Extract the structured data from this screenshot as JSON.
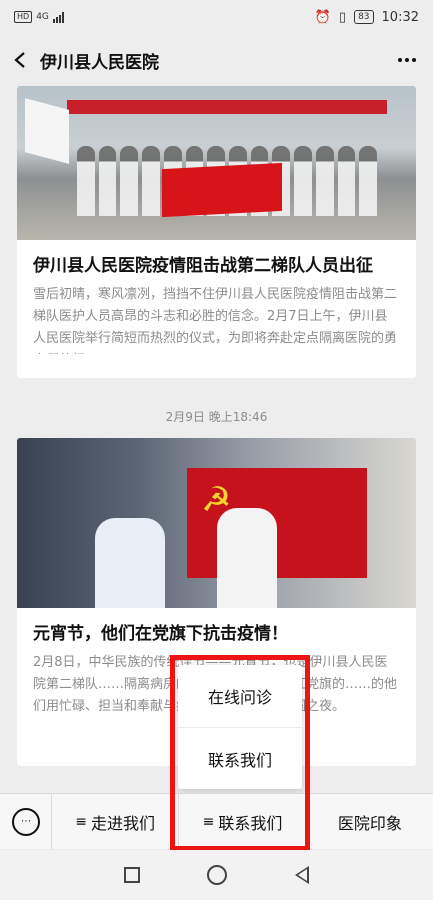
{
  "status_bar": {
    "network_tag": "HD",
    "network_type": "4G",
    "battery": "83",
    "time": "10:32",
    "icons": [
      "alarm-icon",
      "vibrate-icon",
      "battery-icon",
      "signal-icon"
    ]
  },
  "header": {
    "title": "伊川县人民医院",
    "icons": [
      "back-arrow-icon",
      "more-icon"
    ]
  },
  "feed": {
    "articles": [
      {
        "image": "medical-team-group-photo",
        "title": "伊川县人民医院疫情阻击战第二梯队人员出征",
        "summary": "雪后初晴，寒风凛冽，挡挡不住伊川县人民医院疫情阻击战第二梯队医护人员高昂的斗志和必胜的信念。2月7日上午，伊川县人民医院举行简短而热烈的仪式，为即将奔赴定点隔离医院的勇士们壮行。"
      },
      {
        "image": "medical-staff-party-flag-photo",
        "title": "元宵节，他们在党旗下抗击疫情！",
        "summary": "2月8日，中华民族的传统佳节——元宵节，也是伊川县人民医院第二梯队……隔离病房的第二个夜晚，在鲜红党旗的……的他们用忙碌、担当和奉献与病……这个特殊的团圆之夜。"
      }
    ],
    "date_separator": "2月9日 晚上18:46"
  },
  "popup_menu": {
    "items": [
      "在线问诊",
      "联系我们"
    ]
  },
  "menu_bar": {
    "keyboard_icon": "keyboard-icon",
    "buttons": [
      {
        "label": "走进我们",
        "prefix": "≡"
      },
      {
        "label": "联系我们",
        "prefix": "≡"
      },
      {
        "label": "医院印象",
        "prefix": ""
      }
    ]
  },
  "highlight_color": "#ee1414",
  "accent": "#c6121c"
}
